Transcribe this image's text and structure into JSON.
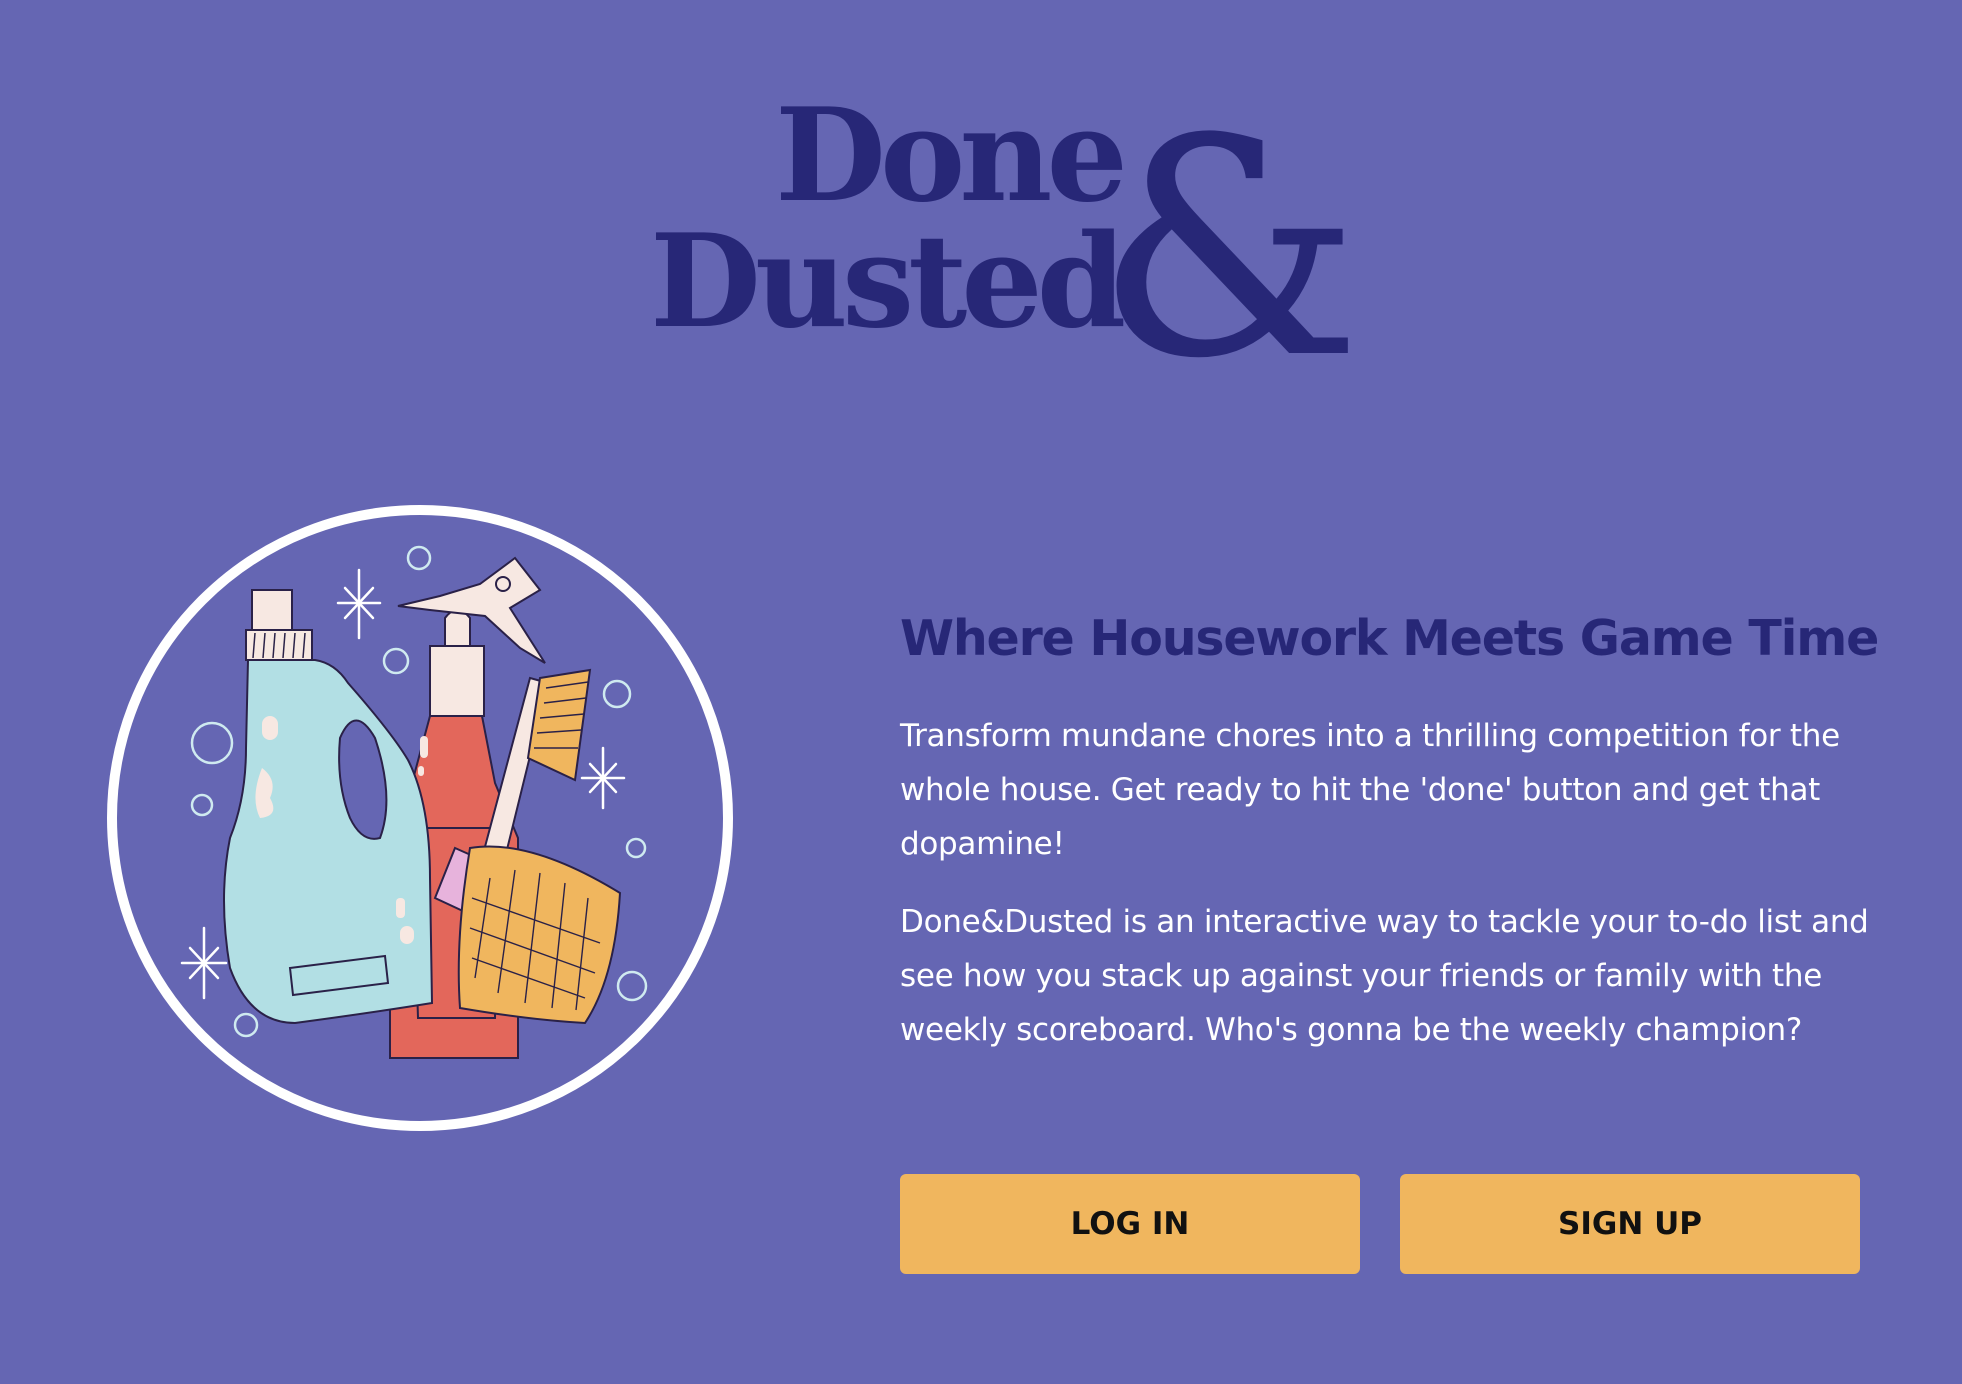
{
  "brand": {
    "line1": "Done",
    "line2": "Dusted",
    "ampersand": "&",
    "color": "#272777"
  },
  "hero": {
    "illustration": "cleaning-supplies-illustration",
    "headline": "Where Housework Meets Game Time",
    "paragraph1": "Transform mundane chores into a thrilling competition for the whole house. Get ready to hit the 'done' button and get that dopamine!",
    "paragraph2": "Done&Dusted is an interactive way to tackle your to-do list and see how you stack up against your friends or family with the weekly scoreboard. Who's gonna be the weekly champion?"
  },
  "actions": {
    "login_label": "LOG IN",
    "signup_label": "SIGN UP"
  },
  "colors": {
    "background": "#6566b3",
    "headline": "#272777",
    "button": "#f0b65e",
    "body_text": "#ffffff"
  }
}
